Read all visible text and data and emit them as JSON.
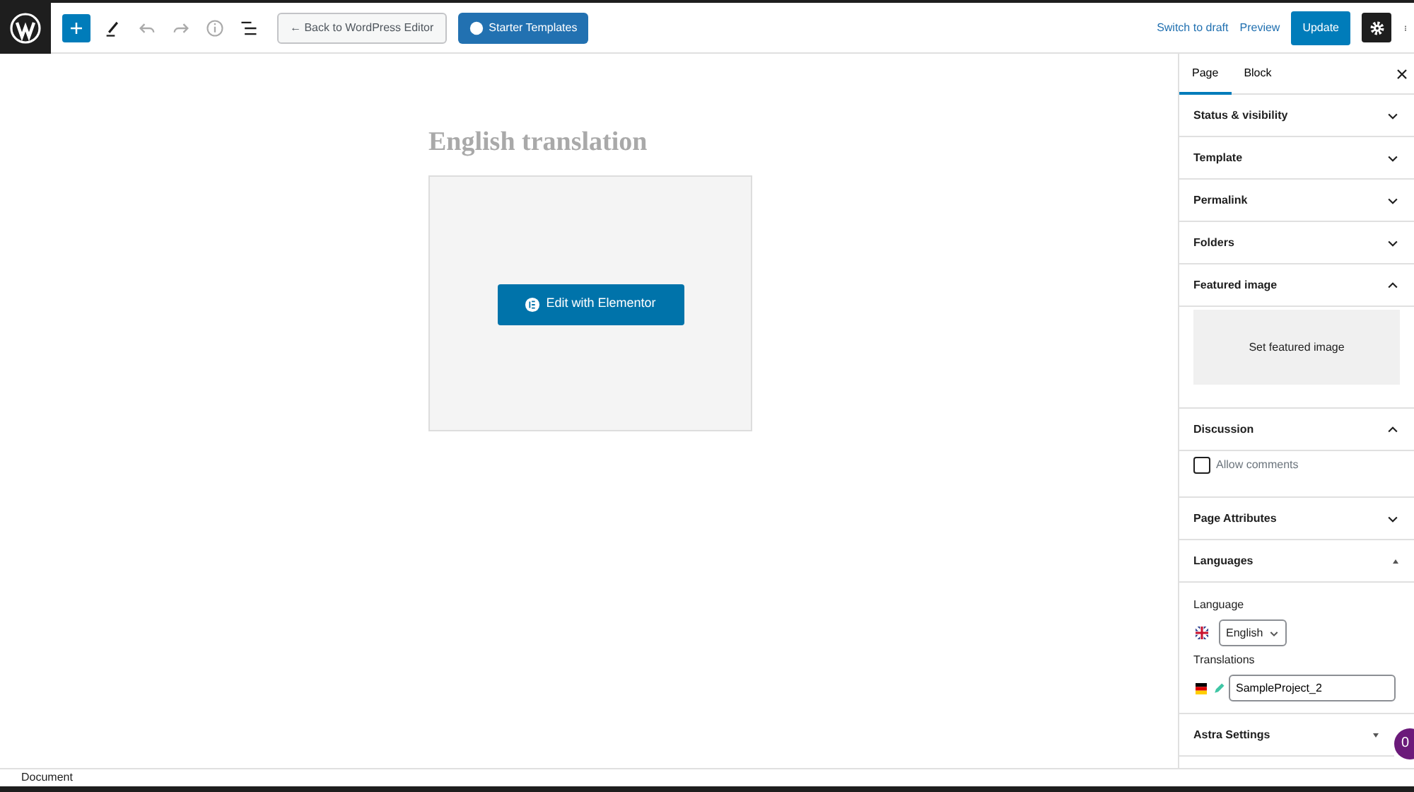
{
  "toolbar": {
    "back_button": "← Back to WordPress Editor",
    "templates_button": "Starter Templates",
    "switch_link": "Switch to draft",
    "preview_link": "Preview",
    "update_button": "Update",
    "settings_selected": true
  },
  "editor": {
    "title": "English translation",
    "elementor_button": "Edit with Elementor"
  },
  "sidebar": {
    "tabs": [
      {
        "label": "Page",
        "selected": true
      },
      {
        "label": "Block",
        "selected": false
      }
    ],
    "panels": [
      {
        "title": "Status & visibility",
        "expanded": false,
        "kind": "chevron"
      },
      {
        "title": "Template",
        "expanded": false,
        "kind": "chevron"
      },
      {
        "title": "Permalink",
        "expanded": false,
        "kind": "chevron"
      },
      {
        "title": "Folders",
        "expanded": false,
        "kind": "chevron"
      },
      {
        "title": "Featured image",
        "expanded": true,
        "kind": "chevron",
        "body": {
          "kind": "featured",
          "button": "Set featured image"
        }
      },
      {
        "title": "Discussion",
        "expanded": true,
        "kind": "chevron",
        "body": {
          "kind": "checkbox",
          "label": "Allow comments",
          "checked": false
        }
      },
      {
        "title": "Page Attributes",
        "expanded": false,
        "kind": "chevron"
      },
      {
        "title": "Languages",
        "expanded": true,
        "kind": "triangle",
        "body": {
          "kind": "languages",
          "language_label": "Language",
          "language": "English",
          "translations_label": "Translations",
          "translation_value": "SampleProject_2"
        }
      },
      {
        "title": "Astra Settings",
        "expanded": false,
        "kind": "triangle"
      }
    ]
  },
  "badge": "0",
  "status_bar": "Document"
}
